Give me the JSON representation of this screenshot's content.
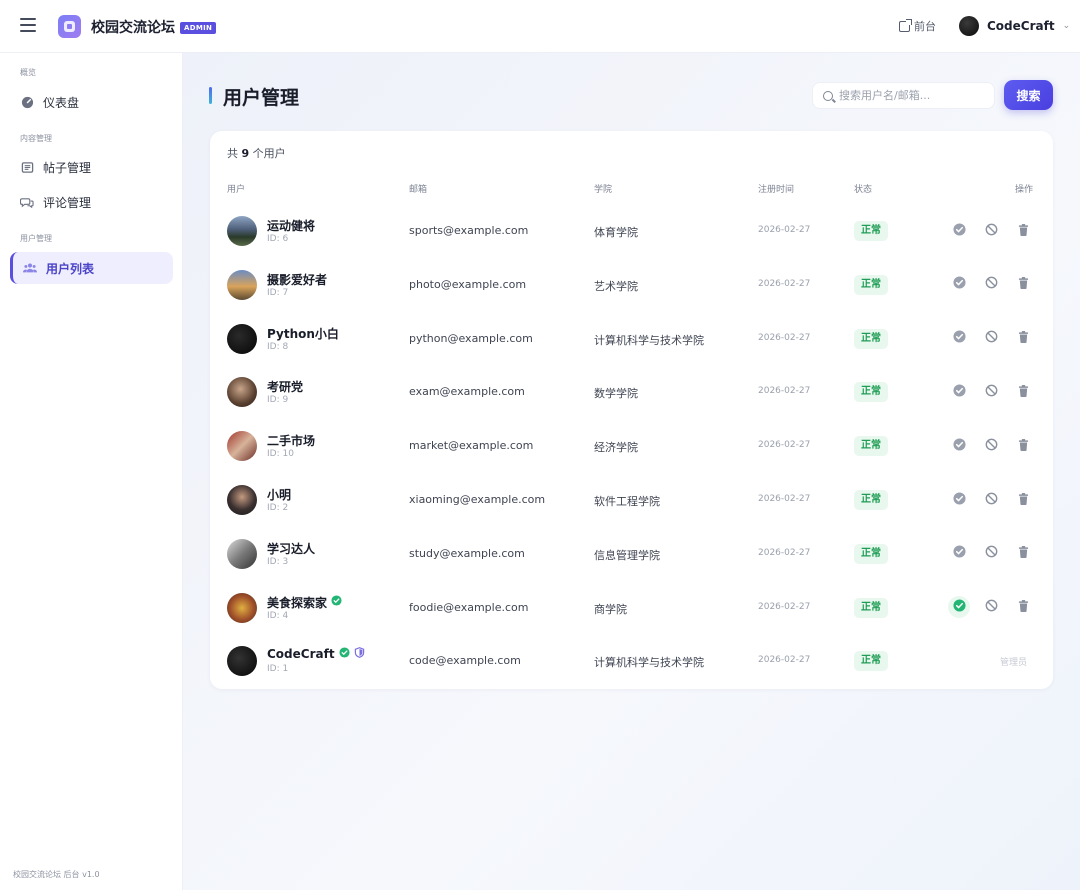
{
  "header": {
    "app_title": "校园交流论坛",
    "admin_badge": "ADMIN",
    "front_link": "前台",
    "user_name": "CodeCraft"
  },
  "sidebar": {
    "sections": [
      {
        "label": "概览"
      },
      {
        "label": "内容管理"
      },
      {
        "label": "用户管理"
      }
    ],
    "items": [
      {
        "label": "仪表盘",
        "icon": "dashboard-icon"
      },
      {
        "label": "帖子管理",
        "icon": "posts-icon"
      },
      {
        "label": "评论管理",
        "icon": "comments-icon"
      },
      {
        "label": "用户列表",
        "icon": "users-icon",
        "active": true
      }
    ],
    "footer": "校园交流论坛 后台 v1.0"
  },
  "main": {
    "title": "用户管理",
    "search_placeholder": "搜索用户名/邮箱...",
    "search_button": "搜索",
    "count_prefix": "共",
    "count_value": "9",
    "count_suffix": "个用户",
    "columns": [
      "用户",
      "邮箱",
      "学院",
      "注册时间",
      "状态",
      "操作"
    ],
    "users": [
      {
        "name": "运动健将",
        "id": "ID: 6",
        "email": "sports@example.com",
        "college": "体育学院",
        "date": "2026-02-27",
        "status": "正常",
        "verified": false
      },
      {
        "name": "摄影爱好者",
        "id": "ID: 7",
        "email": "photo@example.com",
        "college": "艺术学院",
        "date": "2026-02-27",
        "status": "正常",
        "verified": false
      },
      {
        "name": "Python小白",
        "id": "ID: 8",
        "email": "python@example.com",
        "college": "计算机科学与技术学院",
        "date": "2026-02-27",
        "status": "正常",
        "verified": false
      },
      {
        "name": "考研党",
        "id": "ID: 9",
        "email": "exam@example.com",
        "college": "数学学院",
        "date": "2026-02-27",
        "status": "正常",
        "verified": false
      },
      {
        "name": "二手市场",
        "id": "ID: 10",
        "email": "market@example.com",
        "college": "经济学院",
        "date": "2026-02-27",
        "status": "正常",
        "verified": false
      },
      {
        "name": "小明",
        "id": "ID: 2",
        "email": "xiaoming@example.com",
        "college": "软件工程学院",
        "date": "2026-02-27",
        "status": "正常",
        "verified": false
      },
      {
        "name": "学习达人",
        "id": "ID: 3",
        "email": "study@example.com",
        "college": "信息管理学院",
        "date": "2026-02-27",
        "status": "正常",
        "verified": false
      },
      {
        "name": "美食探索家",
        "id": "ID: 4",
        "email": "foodie@example.com",
        "college": "商学院",
        "date": "2026-02-27",
        "status": "正常",
        "verified": true
      },
      {
        "name": "CodeCraft",
        "id": "ID: 1",
        "email": "code@example.com",
        "college": "计算机科学与技术学院",
        "date": "2026-02-27",
        "status": "正常",
        "verified": true,
        "admin": true,
        "locked_label": "管理员"
      }
    ]
  },
  "colors": {
    "accent": "#5b4fe0",
    "status_ok_bg": "#e8f8ee",
    "status_ok_text": "#1f9d55",
    "verified": "#22b573"
  }
}
